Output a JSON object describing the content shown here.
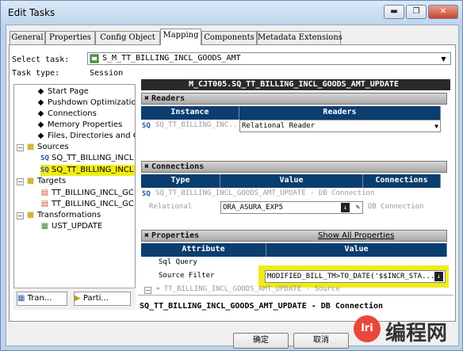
{
  "window": {
    "title": "Edit Tasks",
    "minimize": "▬",
    "restore": "❐",
    "close": "✕"
  },
  "tabs": [
    "General",
    "Properties",
    "Config Object",
    "Mapping",
    "Components",
    "Metadata Extensions"
  ],
  "active_tab": "Mapping",
  "task": {
    "select_label": "Select task:",
    "select_value": "S_M_TT_BILLING_INCL_GOODS_AMT",
    "type_label": "Task type:",
    "type_value": "Session"
  },
  "tree": {
    "items": [
      "Start Page",
      "Pushdown Optimization",
      "Connections",
      "Memory Properties",
      "Files, Directories and Com"
    ],
    "sources_label": "Sources",
    "source_prefix": "SQ",
    "sources": [
      "SQ_TT_BILLING_INCL",
      "SQ_TT_BILLING_INCL"
    ],
    "targets_label": "Targets",
    "targets": [
      "TT_BILLING_INCL_GC",
      "TT_BILLING_INCL_GC"
    ],
    "transformations_label": "Transformations",
    "transformations": [
      "UST_UPDATE"
    ],
    "bottom_tabs": [
      "Tran...",
      "Parti..."
    ]
  },
  "right": {
    "header": "M_CJT005.SQ_TT_BILLING_INCL_GOODS_AMT_UPDATE",
    "readers": {
      "section": "Readers",
      "col_instance": "Instance",
      "col_readers": "Readers",
      "instance": "SQ_TT_BILLING_INC...",
      "reader": "Relational Reader"
    },
    "connections": {
      "section": "Connections",
      "col_type": "Type",
      "col_value": "Value",
      "col_connections": "Connections",
      "row_title": "SQ_TT_BILLING_INCL_GOODS_AMT_UPDATE - DB Connection",
      "type": "Relational",
      "value": "ORA_ASURA_EXP5",
      "connection": "DB Connection"
    },
    "properties": {
      "section": "Properties",
      "show_all": "Show All Properties",
      "col_attribute": "Attribute",
      "col_value": "Value",
      "rows": [
        {
          "attribute": "Sql Query",
          "value": ""
        },
        {
          "attribute": "Source Filter",
          "value": "MODIFIED_BILL_TM>TO_DATE('$$INCR_STA..."
        }
      ],
      "source_row": "TT_BILLING_INCL_GOODS_AMT_UPDATE - Source"
    },
    "status": "SQ_TT_BILLING_INCL_GOODS_AMT_UPDATE - DB Connection"
  },
  "buttons": {
    "ok": "确定",
    "cancel": "取消"
  },
  "watermark": {
    "logo": "lri",
    "text": "编程网"
  },
  "colors": {
    "header_blue": "#0b3d6e",
    "highlight": "#f0ec18",
    "sql_blue": "#2156a6"
  }
}
